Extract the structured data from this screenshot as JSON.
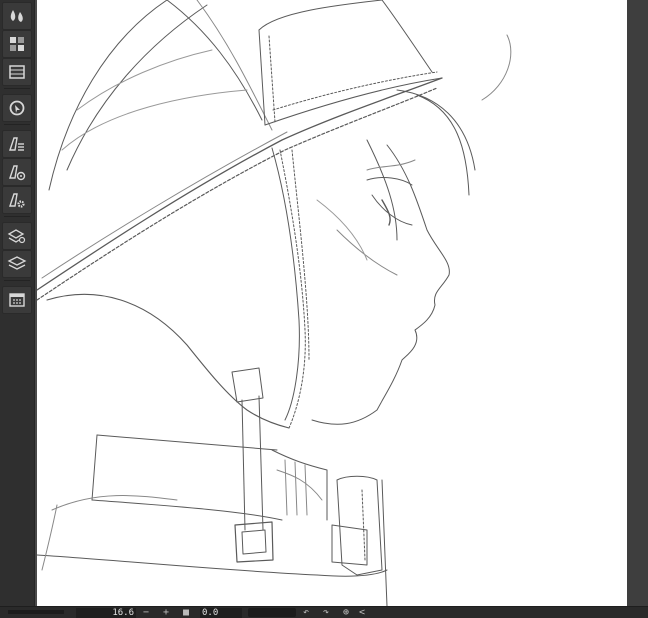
{
  "toolbar": {
    "icons": [
      "color-palette-icon",
      "color-set-icon",
      "timeline-icon",
      "navigator-icon",
      "tool-property-icon",
      "sub-tool-detail-icon",
      "tool-settings-icon",
      "layer-property-icon",
      "layer-icon",
      "material-icon"
    ]
  },
  "canvas": {
    "content": "line-art sketch of a profile character wearing a hat with ear flaps and collar strap"
  },
  "statusbar": {
    "zoom_value": "16.6",
    "zoom_out_label": "−",
    "zoom_in_label": "+",
    "stop_label": "■",
    "rotation_value": "0.0",
    "rotate_left_label": "↶",
    "rotate_right_label": "↷",
    "reset_rotation_label": "⊕",
    "flip_label": "<"
  },
  "colors": {
    "panel_bg": "#2f2f2f",
    "canvas_bg": "#ffffff",
    "line_color": "#555555"
  }
}
